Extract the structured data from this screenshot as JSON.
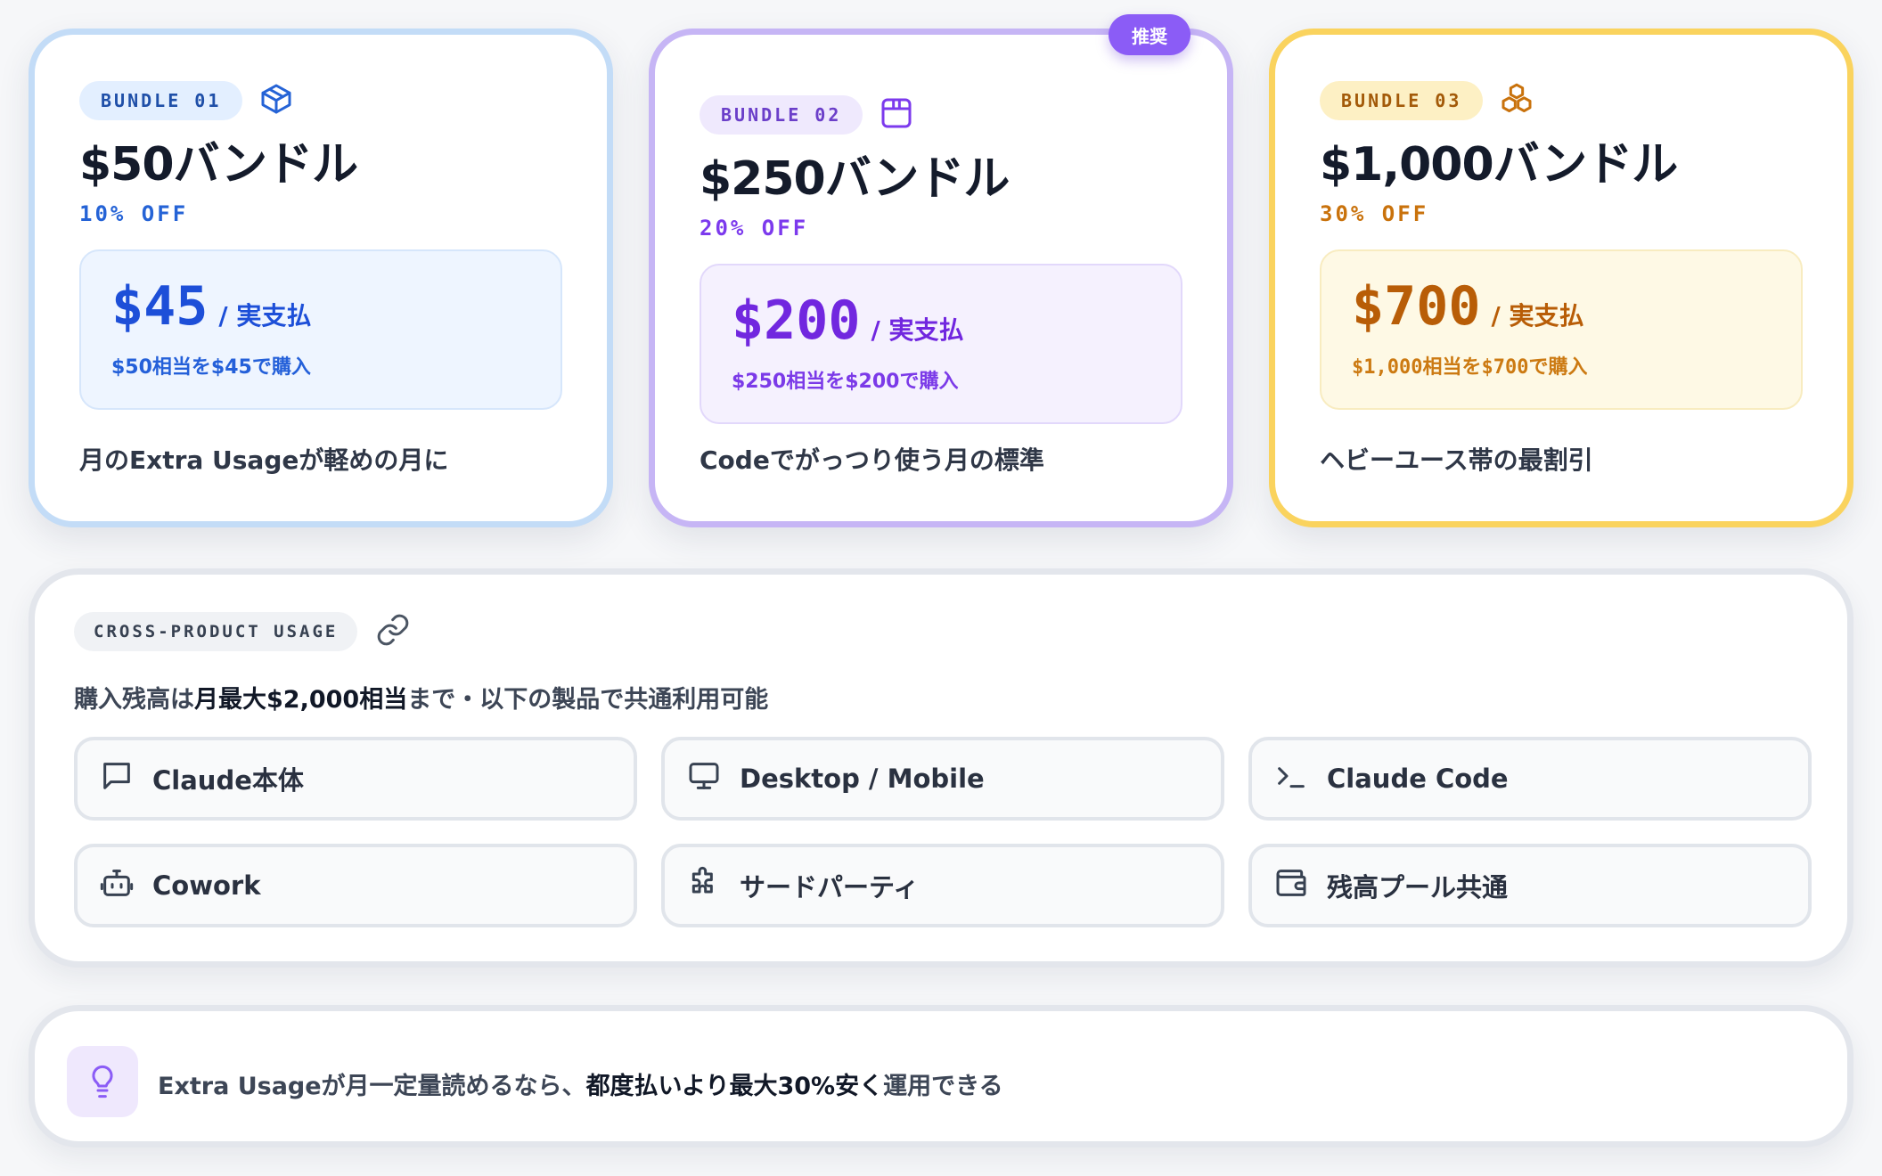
{
  "bundles": [
    {
      "tag": "BUNDLE 01",
      "icon": "package-icon",
      "title": "$50バンドル",
      "discount": "10% OFF",
      "price": "$45",
      "price_unit": "/ 実支払",
      "price_note": "$50相当を$45で購入",
      "description": "月のExtra Usageが軽めの月に",
      "accent": "#2563d6"
    },
    {
      "tag": "BUNDLE 02",
      "icon": "box-icon",
      "title": "$250バンドル",
      "discount": "20% OFF",
      "price": "$200",
      "price_unit": "/ 実支払",
      "price_note": "$250相当を$200で購入",
      "description": "Codeでがっつり使う月の標準",
      "badge": "推奨",
      "accent": "#7c3aed"
    },
    {
      "tag": "BUNDLE 03",
      "icon": "boxes-icon",
      "title": "$1,000バンドル",
      "discount": "30% OFF",
      "price": "$700",
      "price_unit": "/ 実支払",
      "price_note": "$1,000相当を$700で購入",
      "description": "ヘビーユース帯の最割引",
      "accent": "#c9720c"
    }
  ],
  "cross": {
    "tag": "CROSS-PRODUCT USAGE",
    "icon": "link-icon",
    "subtitle_pre": "購入残高は",
    "subtitle_bold": "月最大$2,000相当",
    "subtitle_post": "まで・以下の製品で共通利用可能",
    "products": [
      {
        "label": "Claude本体",
        "icon": "message-square-icon"
      },
      {
        "label": "Desktop / Mobile",
        "icon": "monitor-icon"
      },
      {
        "label": "Claude Code",
        "icon": "terminal-icon"
      },
      {
        "label": "Cowork",
        "icon": "bot-icon"
      },
      {
        "label": "サードパーティ",
        "icon": "puzzle-icon"
      },
      {
        "label": "残高プール共通",
        "icon": "wallet-icon"
      }
    ]
  },
  "tip": {
    "icon": "lightbulb-icon",
    "text_pre": "Extra Usageが月一定量読めるなら、",
    "text_bold": "都度払いより最大30%安く",
    "text_post": "運用できる"
  }
}
